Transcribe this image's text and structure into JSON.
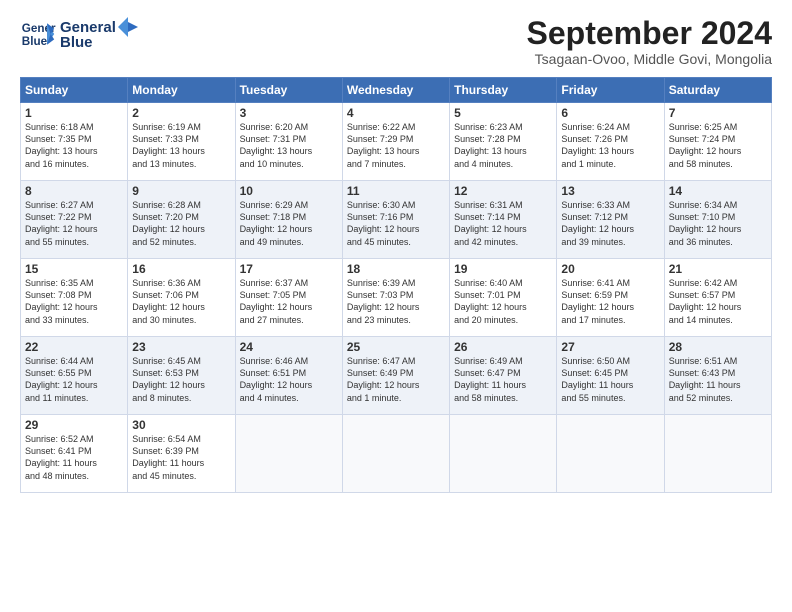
{
  "header": {
    "logo_line1": "General",
    "logo_line2": "Blue",
    "month_title": "September 2024",
    "location": "Tsagaan-Ovoo, Middle Govi, Mongolia"
  },
  "days_of_week": [
    "Sunday",
    "Monday",
    "Tuesday",
    "Wednesday",
    "Thursday",
    "Friday",
    "Saturday"
  ],
  "weeks": [
    [
      {
        "day": "1",
        "info": "Sunrise: 6:18 AM\nSunset: 7:35 PM\nDaylight: 13 hours\nand 16 minutes."
      },
      {
        "day": "2",
        "info": "Sunrise: 6:19 AM\nSunset: 7:33 PM\nDaylight: 13 hours\nand 13 minutes."
      },
      {
        "day": "3",
        "info": "Sunrise: 6:20 AM\nSunset: 7:31 PM\nDaylight: 13 hours\nand 10 minutes."
      },
      {
        "day": "4",
        "info": "Sunrise: 6:22 AM\nSunset: 7:29 PM\nDaylight: 13 hours\nand 7 minutes."
      },
      {
        "day": "5",
        "info": "Sunrise: 6:23 AM\nSunset: 7:28 PM\nDaylight: 13 hours\nand 4 minutes."
      },
      {
        "day": "6",
        "info": "Sunrise: 6:24 AM\nSunset: 7:26 PM\nDaylight: 13 hours\nand 1 minute."
      },
      {
        "day": "7",
        "info": "Sunrise: 6:25 AM\nSunset: 7:24 PM\nDaylight: 12 hours\nand 58 minutes."
      }
    ],
    [
      {
        "day": "8",
        "info": "Sunrise: 6:27 AM\nSunset: 7:22 PM\nDaylight: 12 hours\nand 55 minutes."
      },
      {
        "day": "9",
        "info": "Sunrise: 6:28 AM\nSunset: 7:20 PM\nDaylight: 12 hours\nand 52 minutes."
      },
      {
        "day": "10",
        "info": "Sunrise: 6:29 AM\nSunset: 7:18 PM\nDaylight: 12 hours\nand 49 minutes."
      },
      {
        "day": "11",
        "info": "Sunrise: 6:30 AM\nSunset: 7:16 PM\nDaylight: 12 hours\nand 45 minutes."
      },
      {
        "day": "12",
        "info": "Sunrise: 6:31 AM\nSunset: 7:14 PM\nDaylight: 12 hours\nand 42 minutes."
      },
      {
        "day": "13",
        "info": "Sunrise: 6:33 AM\nSunset: 7:12 PM\nDaylight: 12 hours\nand 39 minutes."
      },
      {
        "day": "14",
        "info": "Sunrise: 6:34 AM\nSunset: 7:10 PM\nDaylight: 12 hours\nand 36 minutes."
      }
    ],
    [
      {
        "day": "15",
        "info": "Sunrise: 6:35 AM\nSunset: 7:08 PM\nDaylight: 12 hours\nand 33 minutes."
      },
      {
        "day": "16",
        "info": "Sunrise: 6:36 AM\nSunset: 7:06 PM\nDaylight: 12 hours\nand 30 minutes."
      },
      {
        "day": "17",
        "info": "Sunrise: 6:37 AM\nSunset: 7:05 PM\nDaylight: 12 hours\nand 27 minutes."
      },
      {
        "day": "18",
        "info": "Sunrise: 6:39 AM\nSunset: 7:03 PM\nDaylight: 12 hours\nand 23 minutes."
      },
      {
        "day": "19",
        "info": "Sunrise: 6:40 AM\nSunset: 7:01 PM\nDaylight: 12 hours\nand 20 minutes."
      },
      {
        "day": "20",
        "info": "Sunrise: 6:41 AM\nSunset: 6:59 PM\nDaylight: 12 hours\nand 17 minutes."
      },
      {
        "day": "21",
        "info": "Sunrise: 6:42 AM\nSunset: 6:57 PM\nDaylight: 12 hours\nand 14 minutes."
      }
    ],
    [
      {
        "day": "22",
        "info": "Sunrise: 6:44 AM\nSunset: 6:55 PM\nDaylight: 12 hours\nand 11 minutes."
      },
      {
        "day": "23",
        "info": "Sunrise: 6:45 AM\nSunset: 6:53 PM\nDaylight: 12 hours\nand 8 minutes."
      },
      {
        "day": "24",
        "info": "Sunrise: 6:46 AM\nSunset: 6:51 PM\nDaylight: 12 hours\nand 4 minutes."
      },
      {
        "day": "25",
        "info": "Sunrise: 6:47 AM\nSunset: 6:49 PM\nDaylight: 12 hours\nand 1 minute."
      },
      {
        "day": "26",
        "info": "Sunrise: 6:49 AM\nSunset: 6:47 PM\nDaylight: 11 hours\nand 58 minutes."
      },
      {
        "day": "27",
        "info": "Sunrise: 6:50 AM\nSunset: 6:45 PM\nDaylight: 11 hours\nand 55 minutes."
      },
      {
        "day": "28",
        "info": "Sunrise: 6:51 AM\nSunset: 6:43 PM\nDaylight: 11 hours\nand 52 minutes."
      }
    ],
    [
      {
        "day": "29",
        "info": "Sunrise: 6:52 AM\nSunset: 6:41 PM\nDaylight: 11 hours\nand 48 minutes."
      },
      {
        "day": "30",
        "info": "Sunrise: 6:54 AM\nSunset: 6:39 PM\nDaylight: 11 hours\nand 45 minutes."
      },
      {
        "day": "",
        "info": ""
      },
      {
        "day": "",
        "info": ""
      },
      {
        "day": "",
        "info": ""
      },
      {
        "day": "",
        "info": ""
      },
      {
        "day": "",
        "info": ""
      }
    ]
  ]
}
